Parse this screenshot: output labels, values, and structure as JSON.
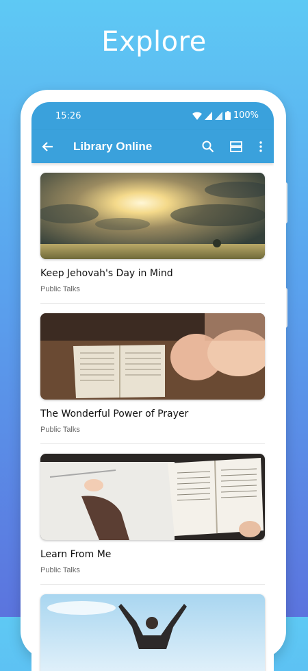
{
  "headline": "Explore",
  "status": {
    "time": "15:26",
    "battery": "100%"
  },
  "appbar": {
    "title": "Library Online"
  },
  "items": [
    {
      "title": "Keep Jehovah's Day in Mind",
      "category": "Public Talks",
      "image": "sunlit-sky-over-field"
    },
    {
      "title": "The Wonderful Power of Prayer",
      "category": "Public Talks",
      "image": "praying-hands-over-bible"
    },
    {
      "title": "Learn From Me",
      "category": "Public Talks",
      "image": "writing-beside-open-bible"
    },
    {
      "title": "",
      "category": "",
      "image": "person-with-raised-arms"
    }
  ]
}
